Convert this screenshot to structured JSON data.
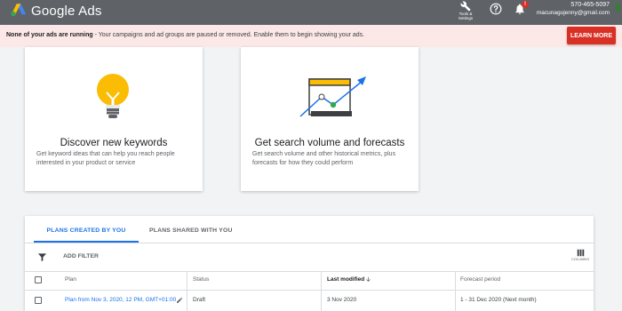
{
  "header": {
    "brand": "Google Ads",
    "tools_label_1": "Tools &",
    "tools_label_2": "Settings",
    "notification_badge": "!",
    "phone": "570-465-5097",
    "email": "macunagujenny@gmail.com"
  },
  "alert": {
    "bold_text": "None of your ads are running",
    "text": " - Your campaigns and ad groups are paused or removed. Enable them to begin showing your ads.",
    "button_label": "LEARN MORE"
  },
  "cards": [
    {
      "title": "Discover new keywords",
      "description": "Get keyword ideas that can help you reach people interested in your product or service",
      "icon": "lightbulb-icon"
    },
    {
      "title": "Get search volume and forecasts",
      "description": "Get search volume and other historical metrics, plus forecasts for how they could perform",
      "icon": "trend-chart-icon"
    }
  ],
  "plans": {
    "tabs": [
      {
        "label": "PLANS CREATED BY YOU",
        "active": true
      },
      {
        "label": "PLANS SHARED WITH YOU",
        "active": false
      }
    ],
    "add_filter_label": "ADD FILTER",
    "columns_label": "COLUMNS",
    "table": {
      "headers": [
        "Plan",
        "Status",
        "Last modified",
        "Forecast period"
      ],
      "rows": [
        {
          "plan": "Plan from Nov 3, 2020, 12 PM, GMT+01:00",
          "status": "Draft",
          "last_modified": "3 Nov 2020",
          "forecast_period": "1 - 31 Dec 2020 (Next month)"
        }
      ]
    }
  },
  "colors": {
    "topbar": "#5f6368",
    "alert_bg": "#fce8e6",
    "alert_button": "#d93025",
    "accent": "#1a73e8",
    "bulb": "#fbbc04"
  }
}
